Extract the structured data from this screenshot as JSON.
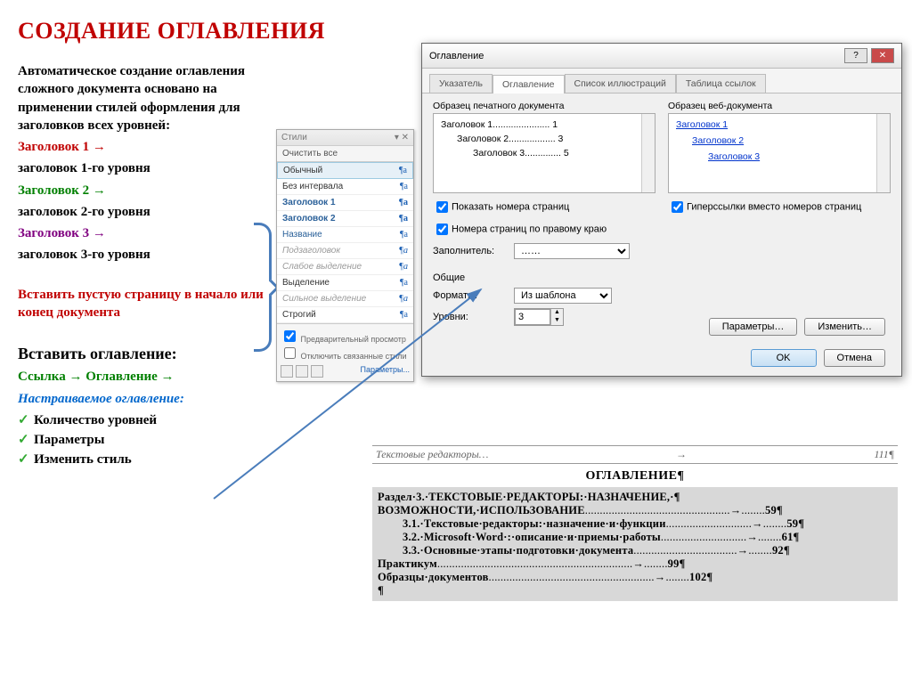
{
  "title": "СОЗДАНИЕ ОГЛАВЛЕНИЯ",
  "intro": "Автоматическое создание оглавления сложного документа основано на применении стилей оформления для заголовков всех уровней",
  "levels": [
    {
      "style": "Заголовок 1 →",
      "desc": "заголовок 1-го уровня",
      "color": "red"
    },
    {
      "style": "Заголовок 2 →",
      "desc": "заголовок 2-го уровня",
      "color": "green"
    },
    {
      "style": "Заголовок 3 →",
      "desc": "заголовок 3-го уровня",
      "color": "purple"
    }
  ],
  "insertBlank": "Вставить пустую страницу  в начало или  конец документа",
  "insertTocTitle": "Вставить оглавление:",
  "path": {
    "a": "Ссылка",
    "b": "Оглавление",
    "arrow": "→"
  },
  "customizable": "Настраиваемое оглавление:",
  "bullets": [
    "Количество уровней",
    "Параметры",
    "Изменить стиль"
  ],
  "stylesPane": {
    "title": "Стили",
    "clearAll": "Очистить все",
    "items": [
      {
        "label": "Обычный",
        "cls": "sel"
      },
      {
        "label": "Без интервала",
        "cls": ""
      },
      {
        "label": "Заголовок 1",
        "cls": "style-blue"
      },
      {
        "label": "Заголовок 2",
        "cls": "style-blue"
      },
      {
        "label": "Название",
        "cls": "style-green"
      },
      {
        "label": "Подзаголовок",
        "cls": "style-light"
      },
      {
        "label": "Слабое выделение",
        "cls": "style-light"
      },
      {
        "label": "Выделение",
        "cls": ""
      },
      {
        "label": "Сильное выделение",
        "cls": "style-light"
      },
      {
        "label": "Строгий",
        "cls": ""
      }
    ],
    "previewChk": "Предварительный просмотр",
    "disableChk": "Отключить связанные стили",
    "paramBtn": "Параметры..."
  },
  "dialog": {
    "title": "Оглавление",
    "help": "?",
    "close": "✕",
    "tabs": [
      "Указатель",
      "Оглавление",
      "Список иллюстраций",
      "Таблица ссылок"
    ],
    "activeTab": 1,
    "printPreviewLabel": "Образец печатного документа",
    "webPreviewLabel": "Образец веб-документа",
    "printPreview": [
      {
        "t": "Заголовок 1",
        "p": "1"
      },
      {
        "t": "Заголовок 2",
        "p": "3"
      },
      {
        "t": "Заголовок 3",
        "p": "5"
      }
    ],
    "webPreview": [
      "Заголовок 1",
      "Заголовок 2",
      "Заголовок 3"
    ],
    "showPages": "Показать номера страниц",
    "rightAlign": "Номера страниц по правому краю",
    "hyperlinks": "Гиперссылки вместо номеров страниц",
    "fillerLabel": "Заполнитель:",
    "fillerValue": "……",
    "generalLabel": "Общие",
    "formatsLabel": "Форматы:",
    "formatsValue": "Из шаблона",
    "levelsLabel": "Уровни:",
    "levelsValue": "3",
    "paramsBtn": "Параметры…",
    "modifyBtn": "Изменить…",
    "okBtn": "OK",
    "cancelBtn": "Отмена"
  },
  "result": {
    "headerLeft": "Текстовые редакторы…",
    "headerRight": "111¶",
    "title": "ОГЛАВЛЕНИЕ¶",
    "lines": [
      "Раздел·3.·ТЕКСТОВЫЕ·РЕДАКТОРЫ:·НАЗНАЧЕНИЕ,·¶",
      "ВОЗМОЖНОСТИ,·ИСПОЛЬЗОВАНИЕ\t59¶",
      "3.1.·Текстовые·редакторы:·назначение·и·функции\t59¶",
      "3.2.·Microsoft·Word·:·описание·и·приемы·работы\t61¶",
      "3.3.·Основные·этапы·подготовки·документа\t92¶",
      "Практикум\t99¶",
      "Образцы·документов\t102¶",
      "¶"
    ]
  }
}
